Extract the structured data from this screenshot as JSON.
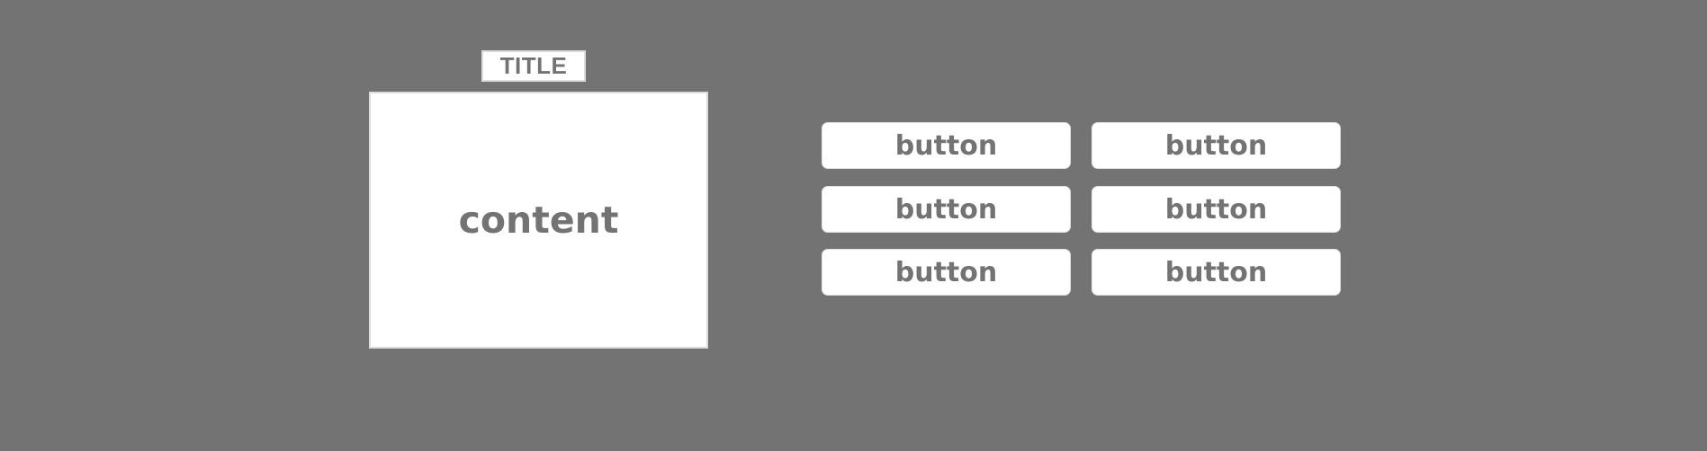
{
  "title": {
    "label": "TITLE"
  },
  "content": {
    "label": "content"
  },
  "buttons": [
    {
      "label": "button"
    },
    {
      "label": "button"
    },
    {
      "label": "button"
    },
    {
      "label": "button"
    },
    {
      "label": "button"
    },
    {
      "label": "button"
    }
  ],
  "colors": {
    "background": "#737373",
    "panel": "#ffffff",
    "text": "#737373"
  }
}
